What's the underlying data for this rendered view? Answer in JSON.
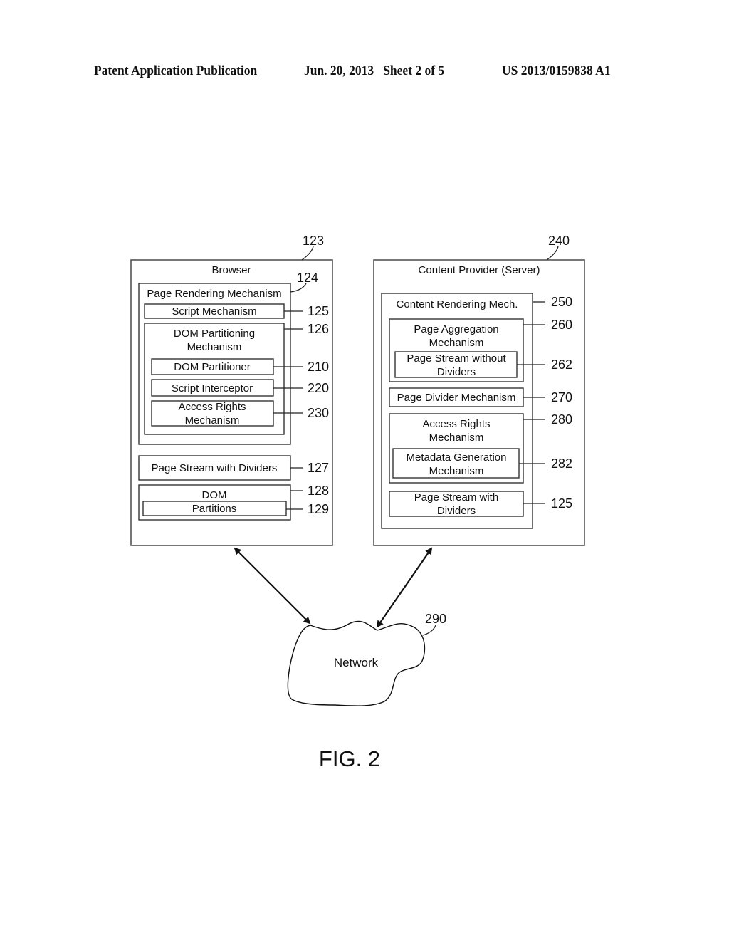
{
  "header": {
    "publication": "Patent Application Publication",
    "date_sheet": "Jun. 20, 2013   Sheet 2 of 5",
    "patent_number": "US 2013/0159838 A1"
  },
  "browser": {
    "ref": "123",
    "title": "Browser",
    "page_rendering": {
      "ref": "124",
      "label": "Page Rendering Mechanism",
      "script_mechanism": {
        "ref": "125",
        "label": "Script Mechanism"
      },
      "dom_partitioning": {
        "ref": "126",
        "label_line1": "DOM Partitioning",
        "label_line2": "Mechanism",
        "dom_partitioner": {
          "ref": "210",
          "label": "DOM Partitioner"
        },
        "script_interceptor": {
          "ref": "220",
          "label": "Script Interceptor"
        },
        "access_rights": {
          "ref": "230",
          "label_line1": "Access Rights",
          "label_line2": "Mechanism"
        }
      }
    },
    "page_stream": {
      "ref": "127",
      "label": "Page Stream with Dividers"
    },
    "dom": {
      "ref": "128",
      "label": "DOM",
      "partitions": {
        "ref": "129",
        "label": "Partitions"
      }
    }
  },
  "server": {
    "ref": "240",
    "title": "Content Provider (Server)",
    "content_rendering": {
      "ref": "250",
      "label": "Content Rendering Mech.",
      "page_aggregation": {
        "ref": "260",
        "label_line1": "Page Aggregation",
        "label_line2": "Mechanism",
        "stream_without": {
          "ref": "262",
          "label_line1": "Page Stream without",
          "label_line2": "Dividers"
        }
      },
      "page_divider": {
        "ref": "270",
        "label": "Page Divider Mechanism"
      },
      "access_rights": {
        "ref": "280",
        "label_line1": "Access Rights",
        "label_line2": "Mechanism",
        "metadata": {
          "ref": "282",
          "label_line1": "Metadata Generation",
          "label_line2": "Mechanism"
        }
      },
      "stream_with": {
        "ref": "125",
        "label_line1": "Page Stream with",
        "label_line2": "Dividers"
      }
    }
  },
  "network": {
    "ref": "290",
    "label": "Network"
  },
  "figure_label": "FIG. 2"
}
